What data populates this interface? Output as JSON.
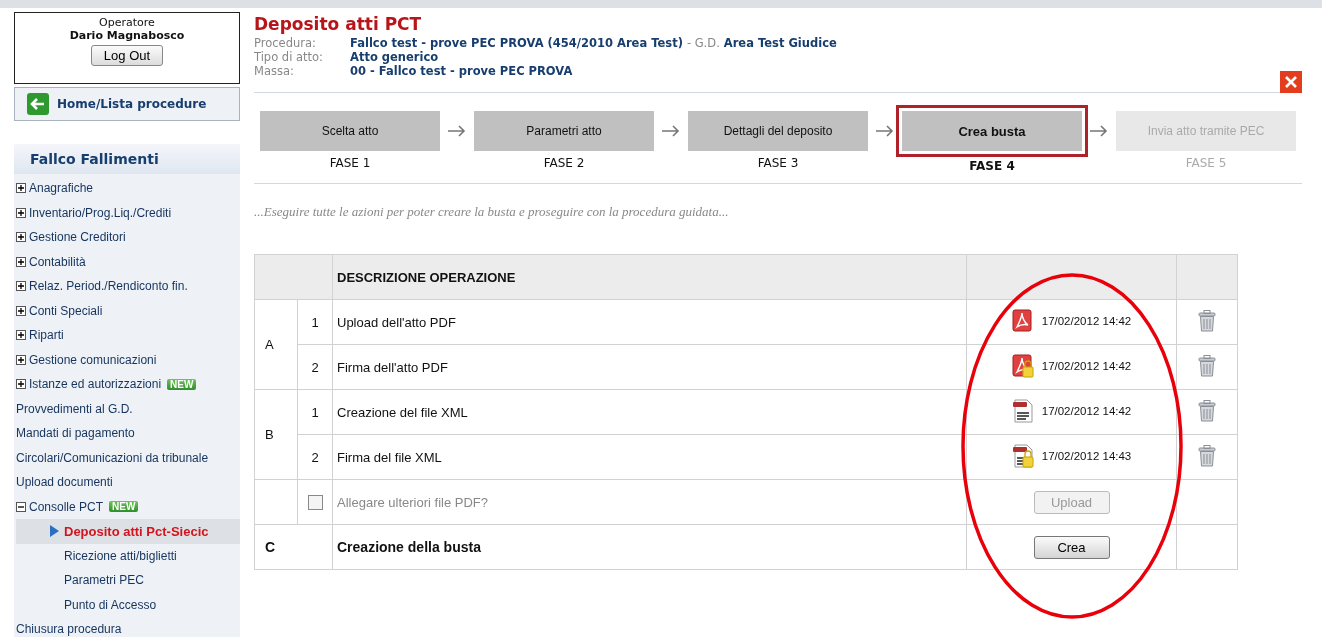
{
  "operator": {
    "label": "Operatore",
    "name": "Dario Magnabosco",
    "logout": "Log Out"
  },
  "home_link": "Home/Lista procedure",
  "sidebar": {
    "title": "Fallco Fallimenti",
    "items": [
      {
        "label": "Anagrafiche",
        "kind": "group",
        "expanded": false
      },
      {
        "label": "Inventario/Prog.Liq./Crediti",
        "kind": "group",
        "expanded": false
      },
      {
        "label": "Gestione Creditori",
        "kind": "group",
        "expanded": false
      },
      {
        "label": "Contabilità",
        "kind": "group",
        "expanded": false
      },
      {
        "label": "Relaz. Period./Rendiconto fin.",
        "kind": "group",
        "expanded": false
      },
      {
        "label": "Conti Speciali",
        "kind": "group",
        "expanded": false
      },
      {
        "label": "Riparti",
        "kind": "group",
        "expanded": false
      },
      {
        "label": "Gestione comunicazioni",
        "kind": "group",
        "expanded": false
      },
      {
        "label": "Istanze ed autorizzazioni",
        "kind": "group",
        "expanded": false,
        "badge": "NEW"
      },
      {
        "label": "Provvedimenti al G.D.",
        "kind": "link"
      },
      {
        "label": "Mandati di pagamento",
        "kind": "link"
      },
      {
        "label": "Circolari/Comunicazioni da tribunale",
        "kind": "link"
      },
      {
        "label": "Upload documenti",
        "kind": "link"
      },
      {
        "label": "Consolle PCT",
        "kind": "group",
        "expanded": true,
        "badge": "NEW",
        "children": [
          {
            "label": "Deposito atti Pct-Siecic",
            "selected": true
          },
          {
            "label": "Ricezione atti/biglietti",
            "selected": false
          },
          {
            "label": "Parametri PEC",
            "selected": false
          },
          {
            "label": "Punto di Accesso",
            "selected": false
          }
        ]
      },
      {
        "label": "Chiusura procedura",
        "kind": "link"
      }
    ]
  },
  "title": "Deposito atti PCT",
  "fields": [
    {
      "label": "Procedura:",
      "value": "Fallco test - prove PEC PROVA (454/2010 Area Test)",
      "extra_label": "- G.D.",
      "extra_value": "Area Test Giudice"
    },
    {
      "label": "Tipo di atto:",
      "value": "Atto generico"
    },
    {
      "label": "Massa:",
      "value": "00 - Fallco test - prove PEC PROVA"
    }
  ],
  "steps": [
    {
      "label": "Scelta atto",
      "phase": "FASE 1",
      "selected": false,
      "disabled": false
    },
    {
      "label": "Parametri atto",
      "phase": "FASE 2",
      "selected": false,
      "disabled": false
    },
    {
      "label": "Dettagli del deposito",
      "phase": "FASE 3",
      "selected": false,
      "disabled": false
    },
    {
      "label": "Crea busta",
      "phase": "FASE 4",
      "selected": true,
      "disabled": false
    },
    {
      "label": "Invia atto tramite PEC",
      "phase": "FASE 5",
      "selected": false,
      "disabled": true
    }
  ],
  "instructions": "...Eseguire tutte le azioni per poter creare la busta e proseguire con la procedura guidata...",
  "table": {
    "columns": [
      "DESCRIZIONE OPERAZIONE"
    ],
    "groups": [
      {
        "letter": "A",
        "rows": [
          {
            "number": "1",
            "description": "Upload dell'atto PDF",
            "kind": "pdf",
            "timestamp": "17/02/2012 14:42"
          },
          {
            "number": "2",
            "description": "Firma dell'atto PDF",
            "kind": "signed-pdf",
            "timestamp": "17/02/2012 14:42"
          }
        ]
      },
      {
        "letter": "B",
        "rows": [
          {
            "number": "1",
            "description": "Creazione del file XML",
            "kind": "xml",
            "timestamp": "17/02/2012 14:42"
          },
          {
            "number": "2",
            "description": "Firma del file XML",
            "kind": "signed-xml",
            "timestamp": "17/02/2012 14:43"
          }
        ]
      }
    ],
    "attach": {
      "label": "Allegare ulteriori file PDF?",
      "checked": false,
      "button": "Upload",
      "disabled": true
    },
    "final": {
      "letter": "C",
      "description": "Creazione della busta",
      "button": "Crea"
    }
  }
}
